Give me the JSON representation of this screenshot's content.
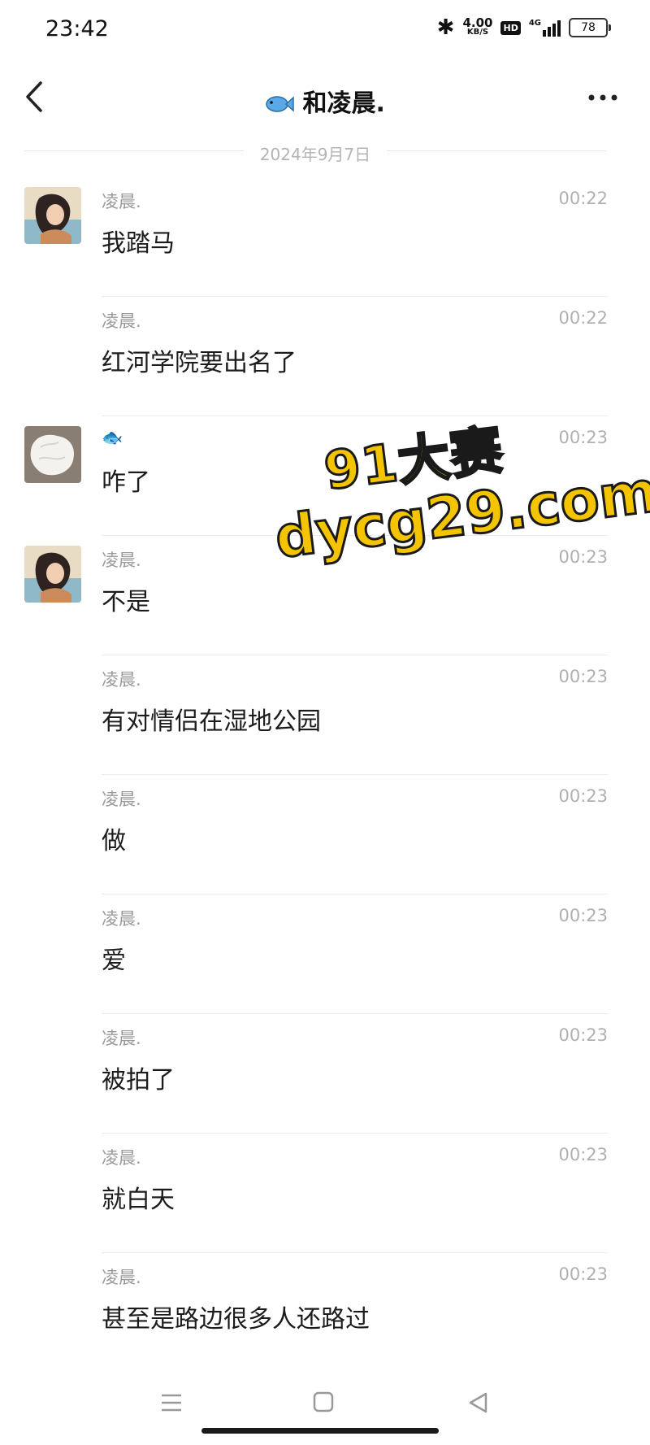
{
  "status_bar": {
    "time": "23:42",
    "net_speed_value": "4.00",
    "net_speed_unit": "KB/S",
    "hd_label": "HD",
    "network_type": "4G",
    "battery": "78"
  },
  "header": {
    "title": "和凌晨.",
    "title_icon": "fish-emoji"
  },
  "date_separator": "2024年9月7日",
  "messages": [
    {
      "sender": "凌晨.",
      "time": "00:22",
      "text": "我踏马",
      "avatar": "illustrated-girl"
    },
    {
      "sender": "凌晨.",
      "time": "00:22",
      "text": "红河学院要出名了",
      "avatar": null
    },
    {
      "sender": "🐟",
      "time": "00:23",
      "text": "咋了",
      "avatar": "white-crumpled"
    },
    {
      "sender": "凌晨.",
      "time": "00:23",
      "text": "不是",
      "avatar": "illustrated-girl"
    },
    {
      "sender": "凌晨.",
      "time": "00:23",
      "text": "有对情侣在湿地公园",
      "avatar": null
    },
    {
      "sender": "凌晨.",
      "time": "00:23",
      "text": "做",
      "avatar": null
    },
    {
      "sender": "凌晨.",
      "time": "00:23",
      "text": "爱",
      "avatar": null
    },
    {
      "sender": "凌晨.",
      "time": "00:23",
      "text": "被拍了",
      "avatar": null
    },
    {
      "sender": "凌晨.",
      "time": "00:23",
      "text": "就白天",
      "avatar": null
    },
    {
      "sender": "凌晨.",
      "time": "00:23",
      "text": "甚至是路边很多人还路过",
      "avatar": null
    }
  ],
  "watermark": {
    "line1": "91大赛",
    "line2": "dycg29.com",
    "color": "#f4c400"
  }
}
